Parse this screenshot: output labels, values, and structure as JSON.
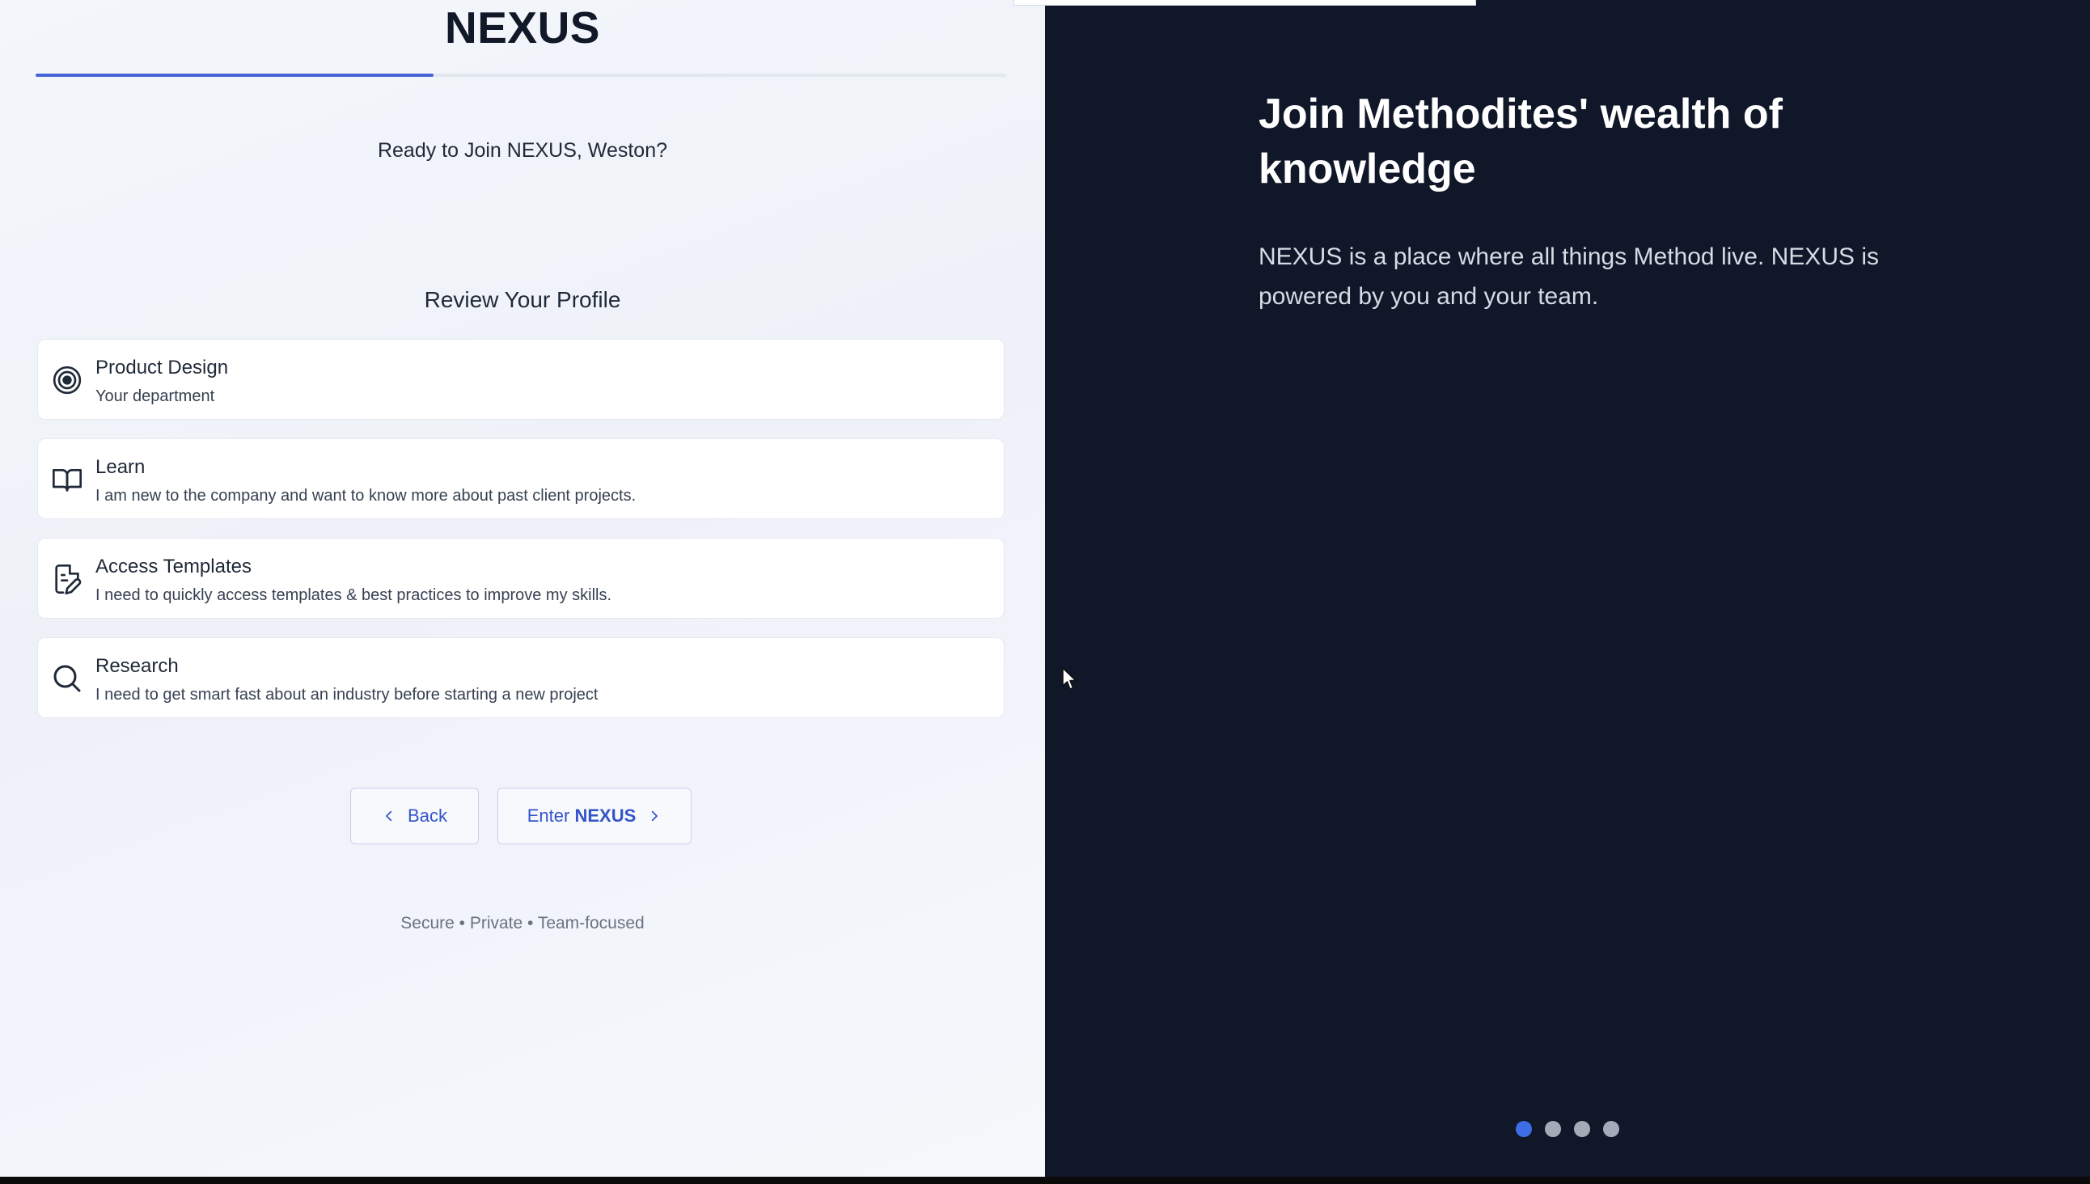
{
  "brand": {
    "name": "NEXUS"
  },
  "progress": {
    "fraction": 0.41
  },
  "greeting": "Ready to Join NEXUS, Weston?",
  "review": {
    "title": "Review Your Profile",
    "items": [
      {
        "icon": "target-icon",
        "title": "Product Design",
        "desc": "Your department"
      },
      {
        "icon": "book-open-icon",
        "title": "Learn",
        "desc": "I am new to the company and want to know more about past client projects."
      },
      {
        "icon": "file-template-icon",
        "title": "Access Templates",
        "desc": "I need to quickly access templates & best practices to improve my skills."
      },
      {
        "icon": "search-icon",
        "title": "Research",
        "desc": "I need to get smart fast about an industry before starting a new project"
      }
    ]
  },
  "actions": {
    "back_label": "Back",
    "enter_prefix": "Enter",
    "enter_brand": "NEXUS"
  },
  "tagline": "Secure • Private • Team-focused",
  "hero": {
    "title": "Join Methodites' wealth of knowledge",
    "body": "NEXUS is a place where all things Method live. NEXUS is powered by you and your team."
  },
  "carousel": {
    "count": 4,
    "active_index": 0
  },
  "colors": {
    "accent": "#3454c9",
    "progress": "#4a63d8",
    "panel_dark": "#0f1729",
    "dot_active": "#3e6ee6",
    "dot_inactive": "#a4abb8"
  }
}
